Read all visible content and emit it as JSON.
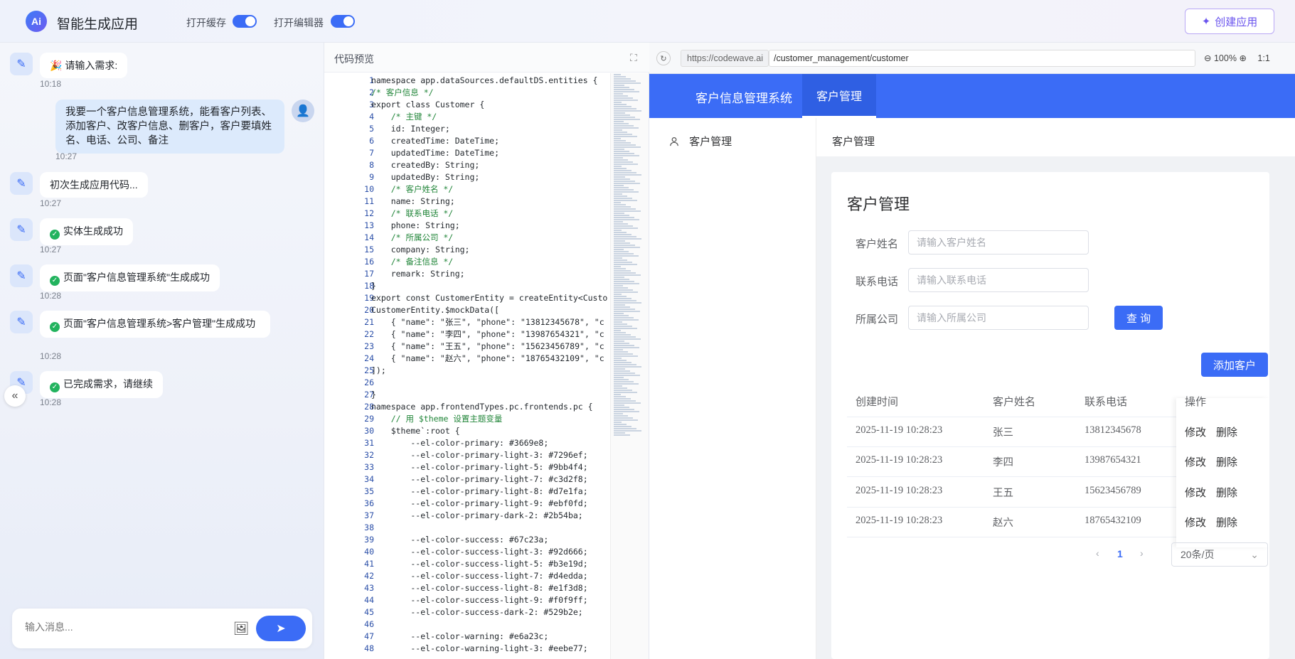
{
  "header": {
    "logo_text": "Ai",
    "title": "智能生成应用",
    "cache_toggle_label": "打开缓存",
    "editor_toggle_label": "打开编辑器",
    "create_button": "创建应用"
  },
  "chat": {
    "messages": [
      {
        "role": "bot",
        "text": "🎉 请输入需求:",
        "time": "10:18"
      },
      {
        "role": "user",
        "text": "我要一个客户信息管理系统，能看客户列表、添加客户、改客户信息、删客户，客户要填姓名、电话、公司、备注",
        "time": "10:27"
      },
      {
        "role": "bot",
        "text": "初次生成应用代码...",
        "time": "10:27"
      },
      {
        "role": "bot",
        "text": "实体生成成功",
        "time": "10:27"
      },
      {
        "role": "bot",
        "text": "页面\"客户信息管理系统\"生成成功",
        "time": "10:28"
      },
      {
        "role": "bot",
        "text": "页面\"客户信息管理系统>客户管理\"生成成功",
        "time": "10:28"
      },
      {
        "role": "bot",
        "text": "已完成需求，请继续",
        "time": "10:28"
      }
    ],
    "input_placeholder": "输入消息..."
  },
  "code_panel": {
    "title": "代码预览",
    "lines": [
      "namespace app.dataSources.defaultDS.entities {",
      "/* 客户信息 */",
      "export class Customer {",
      "    /* 主键 */",
      "    id: Integer;",
      "    createdTime: DateTime;",
      "    updatedTime: DateTime;",
      "    createdBy: String;",
      "    updatedBy: String;",
      "    /* 客户姓名 */",
      "    name: String;",
      "    /* 联系电话 */",
      "    phone: String;",
      "    /* 所属公司 */",
      "    company: String;",
      "    /* 备注信息 */",
      "    remark: String;",
      "}",
      "export const CustomerEntity = createEntity<Custo",
      "CustomerEntity.$mockData([",
      "    { \"name\": \"张三\", \"phone\": \"13812345678\", \"c",
      "    { \"name\": \"李四\", \"phone\": \"13987654321\", \"c",
      "    { \"name\": \"王五\", \"phone\": \"15623456789\", \"c",
      "    { \"name\": \"赵六\", \"phone\": \"18765432109\", \"c",
      "]);",
      "",
      "}",
      "namespace app.frontendTypes.pc.frontends.pc {",
      "    // 用 $theme 设置主题变量",
      "    $theme`:root {",
      "        --el-color-primary: #3669e8;",
      "        --el-color-primary-light-3: #7296ef;",
      "        --el-color-primary-light-5: #9bb4f4;",
      "        --el-color-primary-light-7: #c3d2f8;",
      "        --el-color-primary-light-8: #d7e1fa;",
      "        --el-color-primary-light-9: #ebf0fd;",
      "        --el-color-primary-dark-2: #2b54ba;",
      "",
      "        --el-color-success: #67c23a;",
      "        --el-color-success-light-3: #92d666;",
      "        --el-color-success-light-5: #b3e19d;",
      "        --el-color-success-light-7: #d4edda;",
      "        --el-color-success-light-8: #e1f3d8;",
      "        --el-color-success-light-9: #f0f9ff;",
      "        --el-color-success-dark-2: #529b2e;",
      "",
      "        --el-color-warning: #e6a23c;",
      "        --el-color-warning-light-3: #eebe77;"
    ]
  },
  "preview": {
    "url_base": "https://codewave.ai",
    "url_path": "/customer_management/customer",
    "zoom": "100%",
    "ratio": "1:1",
    "app_name": "客户信息管理系统",
    "nav_tab": "客户管理",
    "side_item": "客户管理",
    "breadcrumb": "客户管理",
    "page_title": "客户管理",
    "form": {
      "name_label": "客户姓名",
      "name_placeholder": "请输入客户姓名",
      "phone_label": "联系电话",
      "phone_placeholder": "请输入联系电话",
      "company_label": "所属公司",
      "company_placeholder": "请输入所属公司",
      "query_button": "查 询"
    },
    "add_button": "添加客户",
    "table": {
      "headers": [
        "创建时间",
        "客户姓名",
        "联系电话",
        "操作"
      ],
      "rows": [
        {
          "created": "2025-11-19 10:28:23",
          "name": "张三",
          "phone": "13812345678"
        },
        {
          "created": "2025-11-19 10:28:23",
          "name": "李四",
          "phone": "13987654321"
        },
        {
          "created": "2025-11-19 10:28:23",
          "name": "王五",
          "phone": "15623456789"
        },
        {
          "created": "2025-11-19 10:28:23",
          "name": "赵六",
          "phone": "18765432109"
        }
      ],
      "edit_label": "修改",
      "delete_label": "删除"
    },
    "pagination": {
      "current": "1",
      "page_size": "20条/页",
      "prev": "‹",
      "next": "›"
    }
  },
  "colors": {
    "primary": "#3b6cf6",
    "success": "#22b35e"
  }
}
